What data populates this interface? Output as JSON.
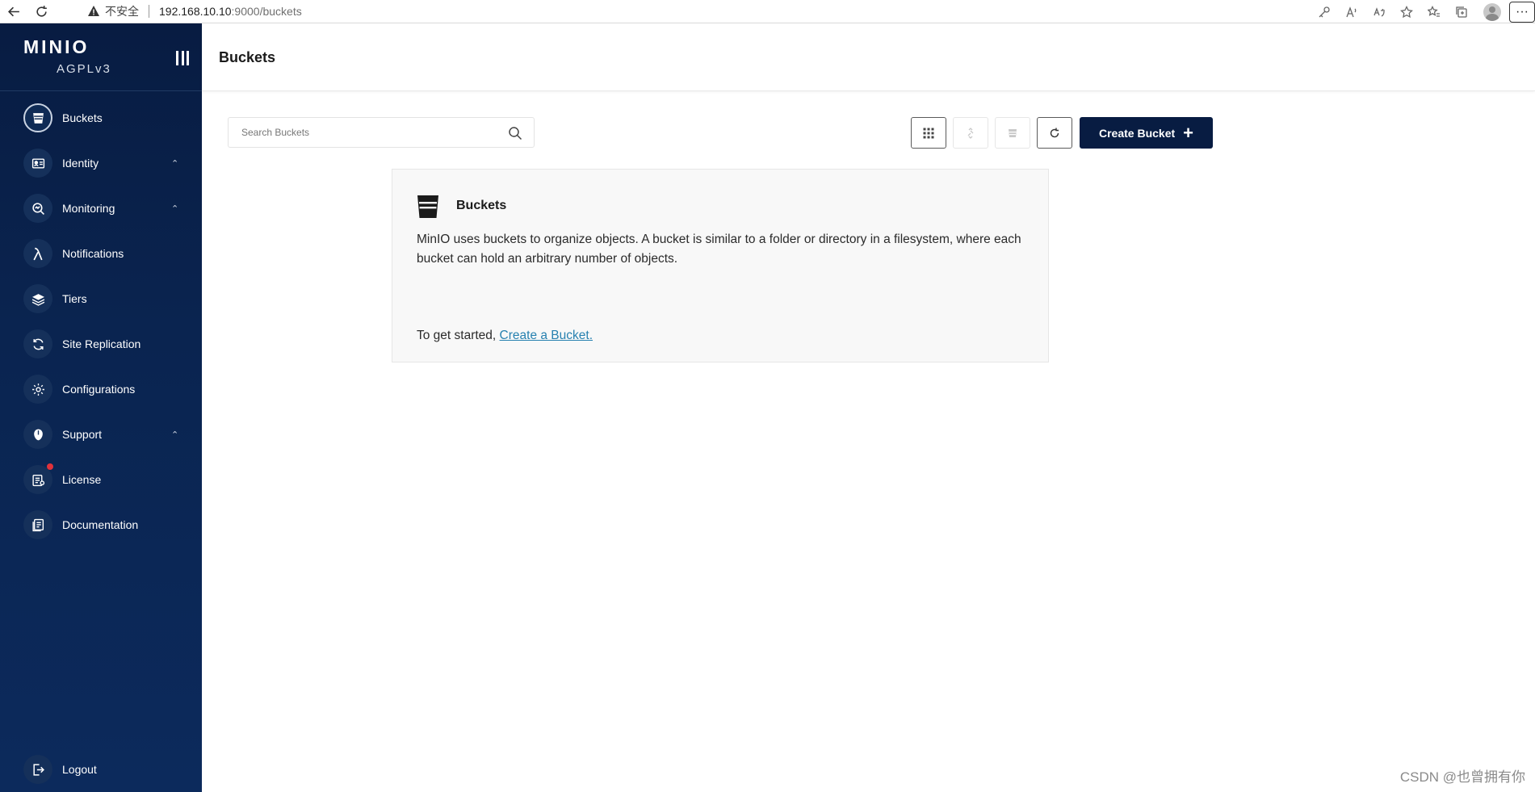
{
  "browser": {
    "security_warning": "不安全",
    "url_host": "192.168.10.10",
    "url_rest": ":9000/buckets"
  },
  "sidebar": {
    "logo": "MINIO",
    "edition": "AGPLv3",
    "items": [
      {
        "label": "Buckets",
        "icon": "bucket-icon",
        "active": true,
        "expandable": false
      },
      {
        "label": "Identity",
        "icon": "id-card-icon",
        "active": false,
        "expandable": true
      },
      {
        "label": "Monitoring",
        "icon": "monitoring-icon",
        "active": false,
        "expandable": true
      },
      {
        "label": "Notifications",
        "icon": "lambda-icon",
        "active": false,
        "expandable": false
      },
      {
        "label": "Tiers",
        "icon": "layers-icon",
        "active": false,
        "expandable": false
      },
      {
        "label": "Site Replication",
        "icon": "replication-icon",
        "active": false,
        "expandable": false
      },
      {
        "label": "Configurations",
        "icon": "gear-icon",
        "active": false,
        "expandable": false
      },
      {
        "label": "Support",
        "icon": "support-icon",
        "active": false,
        "expandable": true
      },
      {
        "label": "License",
        "icon": "license-icon",
        "active": false,
        "expandable": false,
        "has_badge": true
      },
      {
        "label": "Documentation",
        "icon": "documentation-icon",
        "active": false,
        "expandable": false
      }
    ],
    "logout": "Logout"
  },
  "header": {
    "title": "Buckets"
  },
  "toolbar": {
    "search_placeholder": "Search Buckets",
    "create_label": "Create Bucket"
  },
  "info_card": {
    "title": "Buckets",
    "body": "MinIO uses buckets to organize objects. A bucket is similar to a folder or directory in a filesystem, where each bucket can hold an arbitrary number of objects.",
    "footer_prefix": "To get started,",
    "footer_link": "Create a Bucket."
  },
  "watermark": "CSDN @也曾拥有你",
  "colors": {
    "sidebar_bg": "#081c42",
    "create_button_bg": "#081c42",
    "link": "#2781b0",
    "badge": "#e0323b"
  }
}
